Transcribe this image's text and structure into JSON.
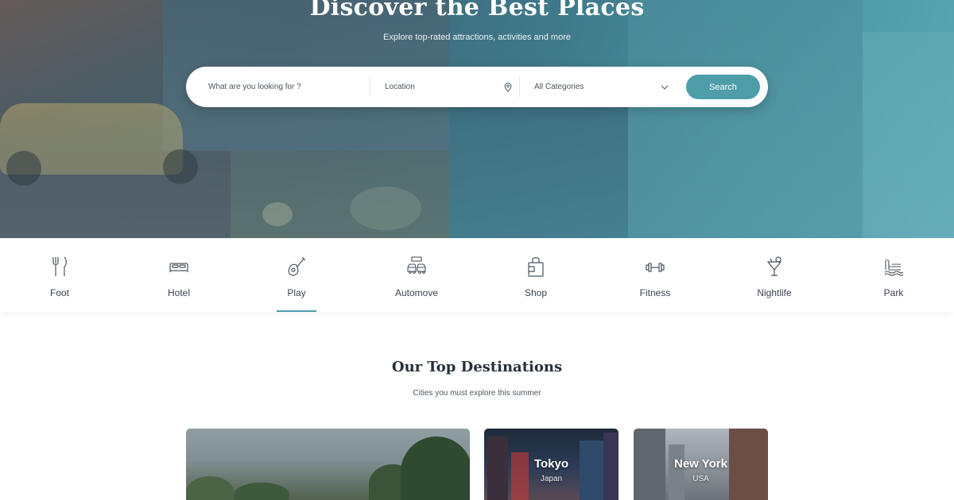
{
  "hero": {
    "title": "Discover the Best Places",
    "subtitle": "Explore top-rated attractions, activities and more"
  },
  "search": {
    "what_placeholder": "What are you looking for ?",
    "location_placeholder": "Location",
    "category_selected": "All Categories",
    "button_label": "Search",
    "location_icon": "map-pin-icon",
    "dropdown_icon": "chevron-down-icon"
  },
  "categories": [
    {
      "label": "Foot",
      "icon": "fork-knife-icon",
      "active": false
    },
    {
      "label": "Hotel",
      "icon": "bed-icon",
      "active": false
    },
    {
      "label": "Play",
      "icon": "guitar-icon",
      "active": true
    },
    {
      "label": "Automove",
      "icon": "car-rental-icon",
      "active": false
    },
    {
      "label": "Shop",
      "icon": "shopping-bag-icon",
      "active": false
    },
    {
      "label": "Fitness",
      "icon": "dumbbell-icon",
      "active": false
    },
    {
      "label": "Nightlife",
      "icon": "cocktail-icon",
      "active": false
    },
    {
      "label": "Park",
      "icon": "park-icon",
      "active": false
    }
  ],
  "destinations": {
    "title": "Our Top Destinations",
    "subtitle": "Cities you must explore this summer",
    "cards": [
      {
        "city": "",
        "country": ""
      },
      {
        "city": "Tokyo",
        "country": "Japan"
      },
      {
        "city": "New York",
        "country": "USA"
      }
    ]
  },
  "colors": {
    "accent": "#4e9eaa",
    "text_dark": "#26303a"
  }
}
